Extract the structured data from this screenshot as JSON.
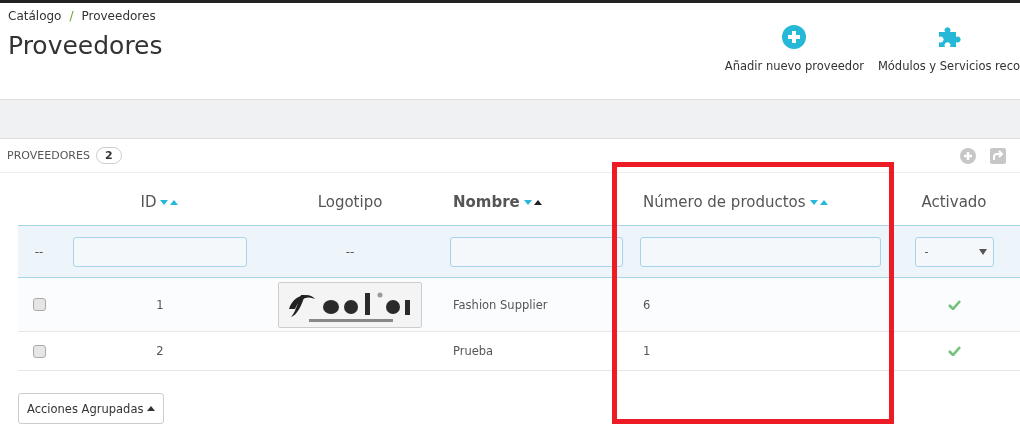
{
  "breadcrumb": {
    "items": [
      "Catálogo",
      "Proveedores"
    ],
    "separator": "/"
  },
  "title": "Proveedores",
  "toolbar": [
    {
      "kind": "add",
      "label": "Añadir nuevo proveedor"
    },
    {
      "kind": "puzzle",
      "label": "Módulos y Servicios reco"
    }
  ],
  "panel": {
    "title": "PROVEEDORES",
    "count": "2"
  },
  "columns": [
    {
      "label": "ID",
      "sortable": true,
      "sorted": false
    },
    {
      "label": "Logotipo",
      "sortable": false,
      "sorted": false
    },
    {
      "label": "Nombre",
      "sortable": true,
      "sorted": true
    },
    {
      "label": "Número de productos",
      "sortable": true,
      "sorted": false
    },
    {
      "label": "Activado",
      "sortable": false,
      "sorted": false
    }
  ],
  "filters": [
    {
      "kind": "text",
      "value": "--"
    },
    {
      "kind": "input"
    },
    {
      "kind": "text",
      "value": "--"
    },
    {
      "kind": "input"
    },
    {
      "kind": "input"
    },
    {
      "kind": "select",
      "value": "-"
    }
  ],
  "rows": [
    {
      "checked": false,
      "id": "1",
      "name": "Fashion Supplier",
      "products": "6",
      "active": true
    },
    {
      "checked": false,
      "id": "2",
      "name": "Prueba",
      "products": "1",
      "active": true
    }
  ],
  "bulk_button": "Acciones Agrupadas"
}
